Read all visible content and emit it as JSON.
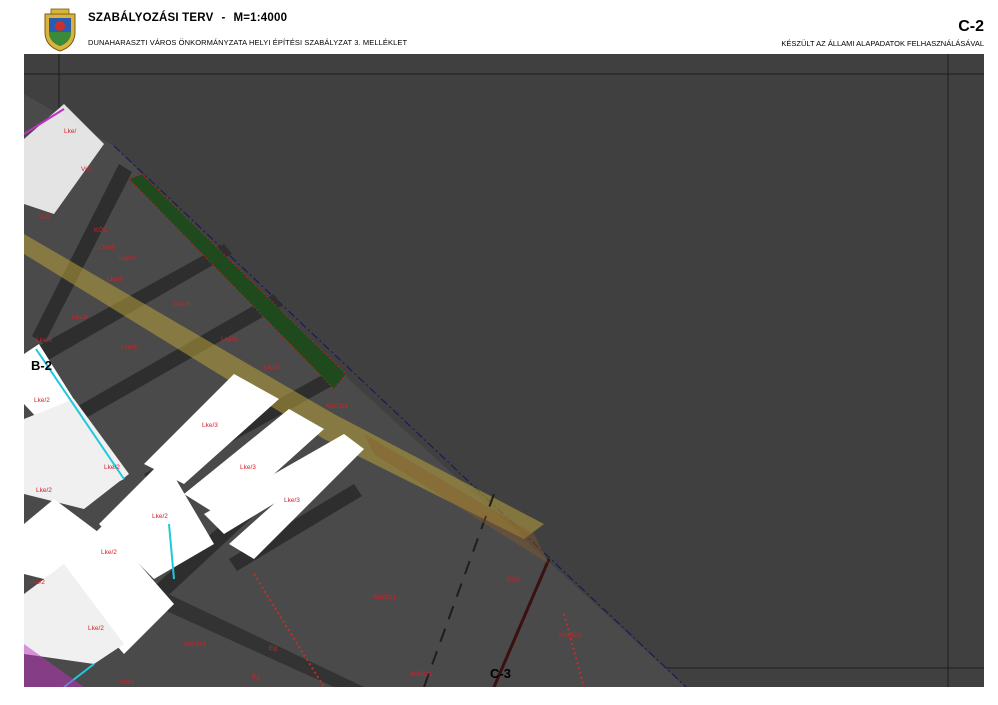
{
  "header": {
    "title": "SZABÁLYOZÁSI TERV",
    "separator": "-",
    "scale": "M=1:4000",
    "subtitle": "DUNAHARASZTI VÁROS ÖNKORMÁNYZATA HELYI ÉPÍTÉSI SZABÁLYZAT 3. MELLÉKLET",
    "sheet_code": "C-2",
    "basemap_note": "KÉSZÜLT AZ ÁLLAMI ALAPADATOK FELHASZNÁLÁSÁVAL"
  },
  "map": {
    "sheet_labels": {
      "west": "B-2",
      "south": "C-3"
    },
    "zones": [
      "Lke/",
      "Vi/2",
      "Vi/2",
      "KÖu",
      "Lke/6",
      "Lke/6",
      "Lke/6",
      "Lke/6",
      "Lke/6",
      "Lke/6",
      "Lke/9",
      "Lke/9",
      "Lke/9",
      "Lke/3",
      "Lke/3",
      "Lke/3",
      "Lke/2",
      "Lke/2",
      "Lke/2",
      "Lke/2",
      "Lke/2",
      "Lke/2",
      "Lke/2",
      "Mü/Sz1",
      "Mü/Sz1",
      "Mü/Sz1",
      "Mü/Sz1",
      "Mü/Sz1",
      "KÖk",
      "Eg",
      "Eg",
      "Mü/8"
    ],
    "colors": {
      "background": "#404040",
      "block": "#4a4a4a",
      "road": "#2e2e2e",
      "parcel": "#ffffff",
      "green": "#1e4a1e",
      "corridor": "#b8a23c",
      "zone_text": "#d0202a",
      "cyan": "#1ec8e0",
      "magenta": "#c030c0"
    }
  }
}
